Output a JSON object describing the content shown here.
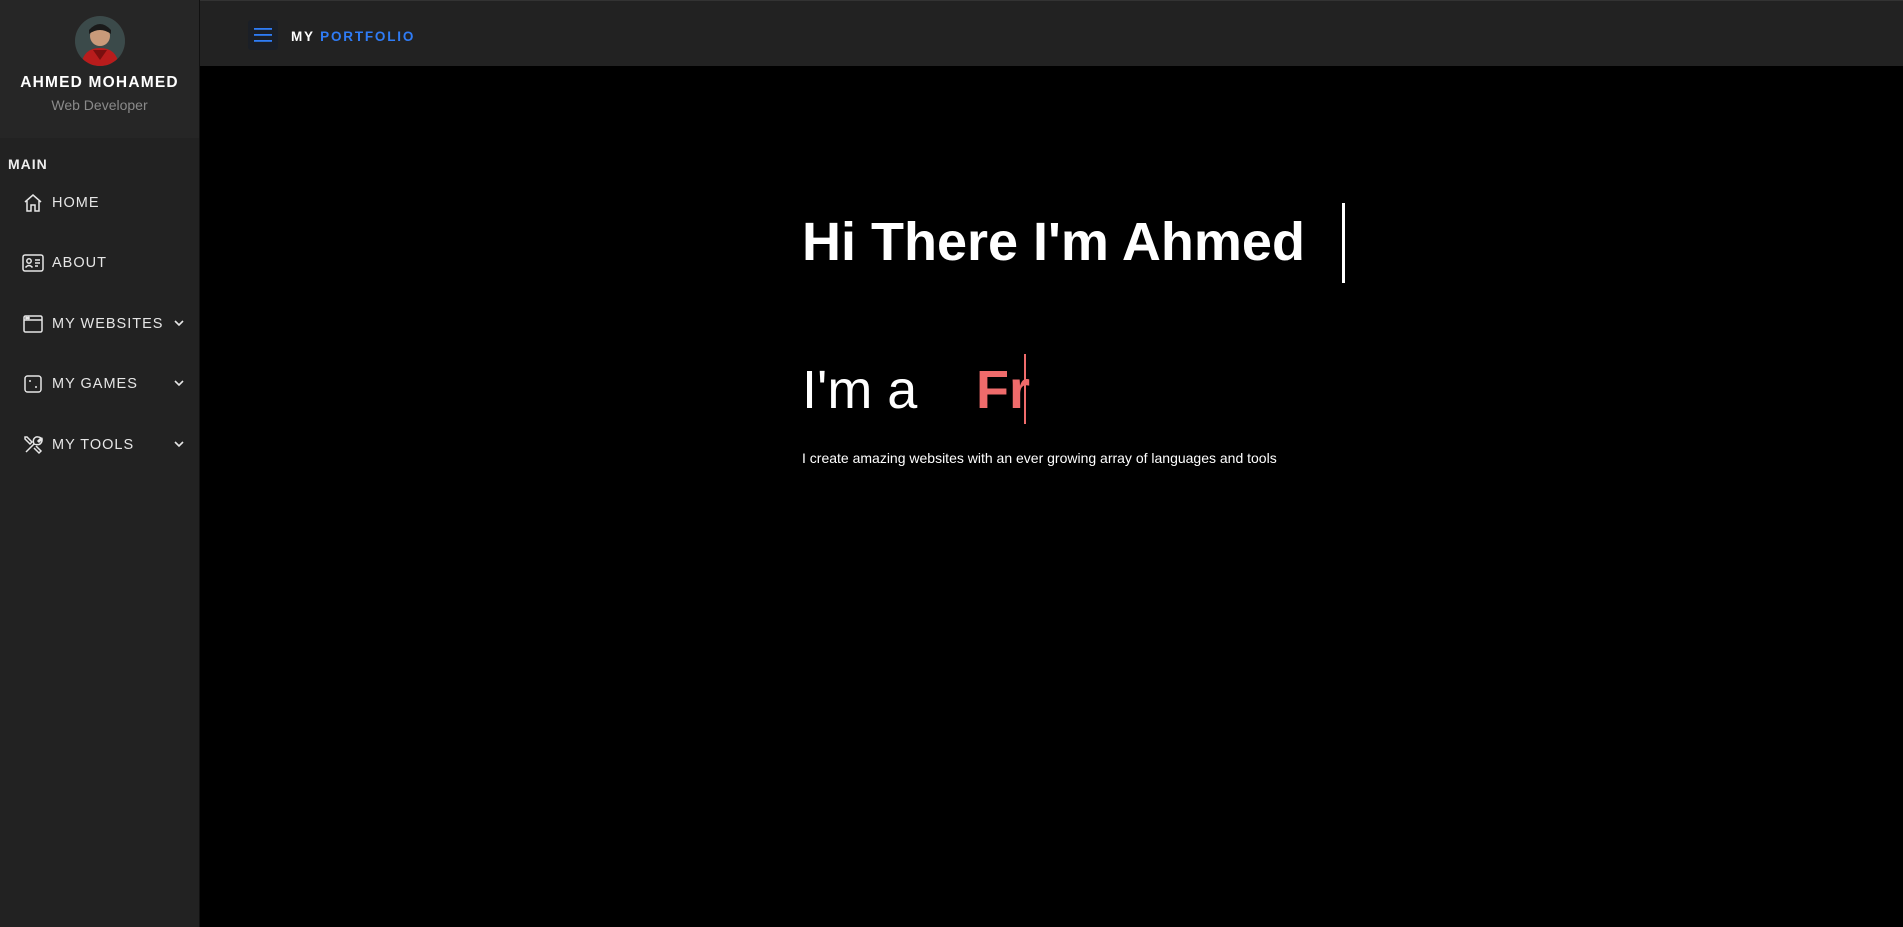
{
  "sidebar": {
    "profile": {
      "name": "AHMED MOHAMED",
      "role": "Web Developer"
    },
    "section_title": "MAIN",
    "items": [
      {
        "label": "HOME",
        "icon": "home-icon"
      },
      {
        "label": "ABOUT",
        "icon": "id-card-icon"
      },
      {
        "label": "MY WEBSITES",
        "icon": "browser-window-icon",
        "expandable": true
      },
      {
        "label": "MY GAMES",
        "icon": "dice-icon",
        "expandable": true
      },
      {
        "label": "MY TOOLS",
        "icon": "tools-icon",
        "expandable": true
      }
    ]
  },
  "topbar": {
    "brand_my": "MY",
    "brand_portfolio": "PORTFOLIO",
    "menu_icon": "hamburger-menu-icon"
  },
  "hero": {
    "title": "Hi There I'm Ahmed",
    "subtitle_prefix": "I'm a",
    "typed_text": "Fr",
    "description": "I create amazing websites with an ever growing array of languages and tools"
  },
  "colors": {
    "sidebar_bg": "#222222",
    "page_bg": "#000000",
    "brand_accent": "#2f7cf6",
    "typed_accent": "#ef6b6b"
  }
}
